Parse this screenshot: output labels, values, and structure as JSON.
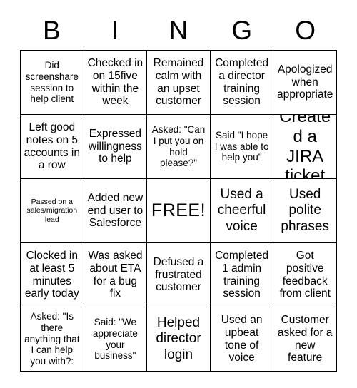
{
  "card": {
    "header_letters": [
      "B",
      "I",
      "N",
      "G",
      "O"
    ],
    "rows": [
      [
        {
          "text": "Did screenshare session to help client",
          "size": "sm"
        },
        {
          "text": "Checked in on 15five within the week",
          "size": "md"
        },
        {
          "text": "Remained calm with an upset customer",
          "size": "md"
        },
        {
          "text": "Completed a director training session",
          "size": "md"
        },
        {
          "text": "Apologized when appropriate",
          "size": "md"
        }
      ],
      [
        {
          "text": "Left good notes on 5 accounts in a row",
          "size": "md"
        },
        {
          "text": "Expressed willingness to help",
          "size": "md"
        },
        {
          "text": "Asked: \"Can I put you on hold please?\"",
          "size": "sm"
        },
        {
          "text": "Said \"I hope I was able to help you\"",
          "size": "sm"
        },
        {
          "text": "Created a JIRA ticket",
          "size": "xl"
        }
      ],
      [
        {
          "text": "Passed on a sales/migration lead",
          "size": "xs"
        },
        {
          "text": "Added new end user to Salesforce",
          "size": "md"
        },
        {
          "text": "FREE!",
          "size": "free"
        },
        {
          "text": "Used a cheerful voice",
          "size": "lg"
        },
        {
          "text": "Used polite phrases",
          "size": "lg"
        }
      ],
      [
        {
          "text": "Clocked in at least 5 minutes early today",
          "size": "md"
        },
        {
          "text": "Was asked about ETA for a bug fix",
          "size": "md"
        },
        {
          "text": "Defused a frustrated customer",
          "size": "md"
        },
        {
          "text": "Completed 1 admin training session",
          "size": "md"
        },
        {
          "text": "Got positive feedback from client",
          "size": "md"
        }
      ],
      [
        {
          "text": "Asked: \"Is there anything that I can help you with?:",
          "size": "sm"
        },
        {
          "text": "Said: \"We appreciate your business\"",
          "size": "sm"
        },
        {
          "text": "Helped director login",
          "size": "lg"
        },
        {
          "text": "Used an upbeat tone of voice",
          "size": "md"
        },
        {
          "text": "Customer asked for a new feature",
          "size": "md"
        }
      ]
    ]
  },
  "colors": {
    "background": "#ffffff",
    "border": "#000000",
    "text": "#000000"
  }
}
